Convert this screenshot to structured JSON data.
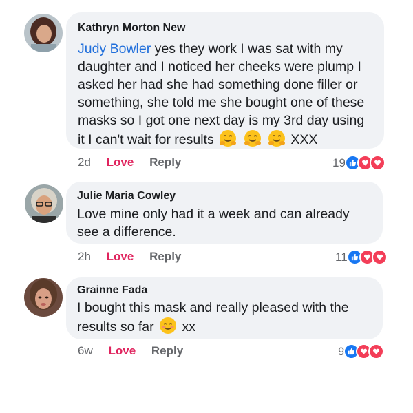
{
  "comments": [
    {
      "author": "Kathryn Morton New",
      "mention": "Judy Bowler",
      "lines": [
        " yes they work I was sat with my",
        "daughter and I noticed her cheeks were plump I",
        "asked her had she had something done filler or",
        "something, she told me she bought one of these",
        "masks so I got one next day is my 3rd day using",
        "it I can't wait for results"
      ],
      "suffix": "XXX",
      "time": "2d",
      "love_label": "Love",
      "reply_label": "Reply",
      "reaction_count": "19",
      "avatar_colors": {
        "hair": "#4a2a22",
        "skin": "#d9a88a"
      }
    },
    {
      "author": "Julie Maria Cowley",
      "lines": [
        "Love mine only had it a week and can already",
        "see a difference."
      ],
      "time": "2h",
      "love_label": "Love",
      "reply_label": "Reply",
      "reaction_count": "11",
      "avatar_colors": {
        "hair": "#d8d3c8",
        "skin": "#d9a27e"
      }
    },
    {
      "author": "Grainne Fada",
      "line1": "I bought this mask and really pleased with the",
      "line2_prefix": "results so far",
      "line2_suffix": "xx",
      "time": "6w",
      "love_label": "Love",
      "reply_label": "Reply",
      "reaction_count": "9",
      "avatar_colors": {
        "hair": "#5a3b2a",
        "skin": "#d89f86"
      }
    }
  ],
  "colors": {
    "bubble": "#f0f2f5",
    "love": "#e0245e",
    "mention": "#216fdb",
    "like_reaction": "#1877f2",
    "love_reaction": "#f33e58"
  },
  "icons": {
    "reactions": [
      "like-icon",
      "love-icon",
      "haha-icon"
    ],
    "emoji_comment1": "hugging-face-emoji",
    "emoji_comment3": "smiling-face-emoji"
  }
}
